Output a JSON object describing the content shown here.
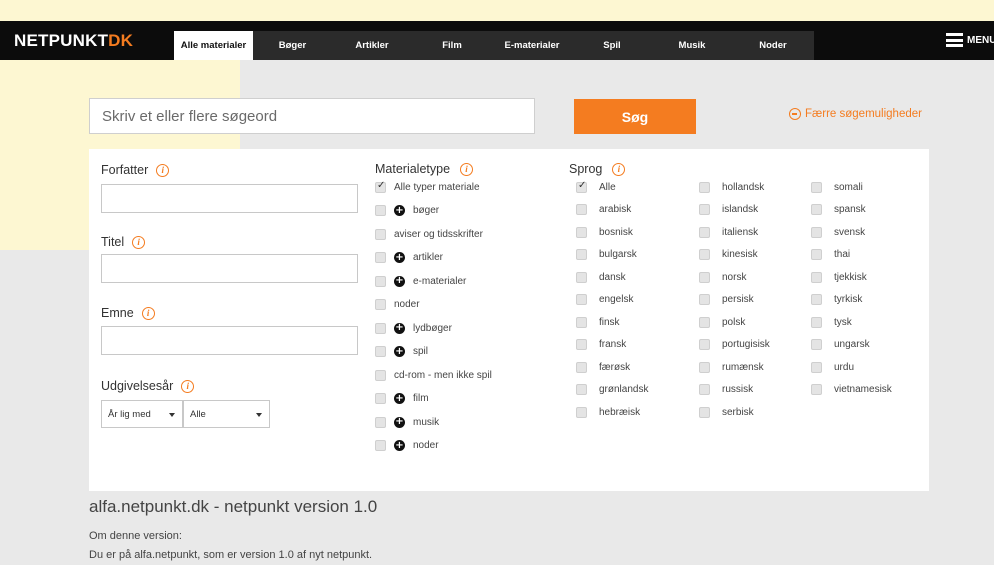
{
  "header": {
    "logo_main": "NETPUNKT",
    "logo_accent": "DK",
    "tabs": [
      {
        "label": "Alle materialer"
      },
      {
        "label": "Bøger"
      },
      {
        "label": "Artikler"
      },
      {
        "label": "Film"
      },
      {
        "label": "E-materialer"
      },
      {
        "label": "Spil"
      },
      {
        "label": "Musik"
      },
      {
        "label": "Noder"
      }
    ],
    "menu_label": "MENU"
  },
  "search": {
    "placeholder": "Skriv et eller flere søgeord",
    "button_label": "Søg",
    "fewer_options": "Færre søgemuligheder"
  },
  "fields": {
    "author_label": "Forfatter",
    "title_label": "Titel",
    "subject_label": "Emne",
    "year_label": "Udgivelsesår",
    "year_operator": "År lig med",
    "year_value": "Alle"
  },
  "material_type": {
    "label": "Materialetype",
    "items": [
      {
        "label": "Alle typer materiale",
        "checked": true,
        "expandable": false
      },
      {
        "label": "bøger",
        "checked": false,
        "expandable": true
      },
      {
        "label": "aviser og tidsskrifter",
        "checked": false,
        "expandable": false
      },
      {
        "label": "artikler",
        "checked": false,
        "expandable": true
      },
      {
        "label": "e-materialer",
        "checked": false,
        "expandable": true
      },
      {
        "label": "noder",
        "checked": false,
        "expandable": false
      },
      {
        "label": "lydbøger",
        "checked": false,
        "expandable": true
      },
      {
        "label": "spil",
        "checked": false,
        "expandable": true
      },
      {
        "label": "cd-rom - men ikke spil",
        "checked": false,
        "expandable": false
      },
      {
        "label": "film",
        "checked": false,
        "expandable": true
      },
      {
        "label": "musik",
        "checked": false,
        "expandable": true
      },
      {
        "label": "noder",
        "checked": false,
        "expandable": true
      }
    ]
  },
  "language": {
    "label": "Sprog",
    "col1": [
      {
        "label": "Alle",
        "checked": true
      },
      {
        "label": "arabisk",
        "checked": false
      },
      {
        "label": "bosnisk",
        "checked": false
      },
      {
        "label": "bulgarsk",
        "checked": false
      },
      {
        "label": "dansk",
        "checked": false
      },
      {
        "label": "engelsk",
        "checked": false
      },
      {
        "label": "finsk",
        "checked": false
      },
      {
        "label": "fransk",
        "checked": false
      },
      {
        "label": "færøsk",
        "checked": false
      },
      {
        "label": "grønlandsk",
        "checked": false
      },
      {
        "label": "hebræisk",
        "checked": false
      }
    ],
    "col2": [
      {
        "label": "hollandsk",
        "checked": false
      },
      {
        "label": "islandsk",
        "checked": false
      },
      {
        "label": "italiensk",
        "checked": false
      },
      {
        "label": "kinesisk",
        "checked": false
      },
      {
        "label": "norsk",
        "checked": false
      },
      {
        "label": "persisk",
        "checked": false
      },
      {
        "label": "polsk",
        "checked": false
      },
      {
        "label": "portugisisk",
        "checked": false
      },
      {
        "label": "rumænsk",
        "checked": false
      },
      {
        "label": "russisk",
        "checked": false
      },
      {
        "label": "serbisk",
        "checked": false
      }
    ],
    "col3": [
      {
        "label": "somali",
        "checked": false
      },
      {
        "label": "spansk",
        "checked": false
      },
      {
        "label": "svensk",
        "checked": false
      },
      {
        "label": "thai",
        "checked": false
      },
      {
        "label": "tjekkisk",
        "checked": false
      },
      {
        "label": "tyrkisk",
        "checked": false
      },
      {
        "label": "tysk",
        "checked": false
      },
      {
        "label": "ungarsk",
        "checked": false
      },
      {
        "label": "urdu",
        "checked": false
      },
      {
        "label": "vietnamesisk",
        "checked": false
      }
    ]
  },
  "footer": {
    "title": "alfa.netpunkt.dk - netpunkt version 1.0",
    "line1": "Om denne version:",
    "line2": "Du er på alfa.netpunkt, som er version 1.0 af nyt netpunkt."
  },
  "colors": {
    "accent": "#f47c20",
    "topbar": "#0c0c0c",
    "page_bg": "#e9e9e9"
  }
}
